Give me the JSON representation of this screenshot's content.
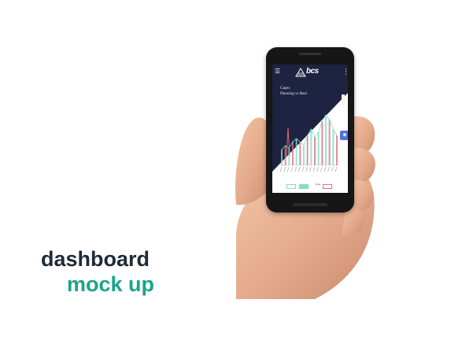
{
  "app": {
    "logo_text": "bcs"
  },
  "chart_data": {
    "type": "line",
    "title": "Capex",
    "subtitle": "Planning vs Real",
    "legend": [
      "",
      "",
      "Real",
      ""
    ],
    "series": [
      {
        "name": "Real",
        "values": [
          2,
          2.5,
          2.2,
          3,
          3.4,
          3,
          2.6,
          3.8,
          4.6,
          3.6,
          4.2,
          5.6,
          6.4,
          5.8,
          4.6,
          3.8
        ]
      }
    ]
  },
  "colors": {
    "appbar": "#1d2340",
    "accent_teal": "#1aa58a",
    "fab": "#4f6fe0",
    "series_teal": "#7fe0c8",
    "series_red": "#e07080"
  },
  "tagline": {
    "line1": "dashboard",
    "line2": "mock up"
  },
  "icons": {
    "menu": "menu-icon",
    "more": "kebab-icon",
    "fab": "settings-icon"
  }
}
